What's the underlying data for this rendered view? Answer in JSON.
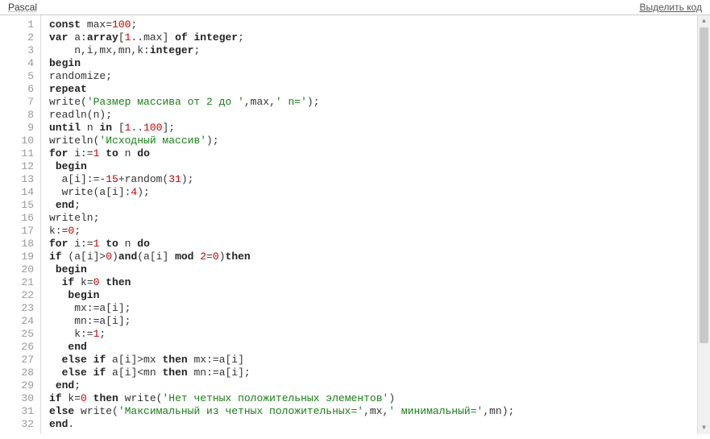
{
  "header": {
    "language": "Pascal",
    "select_code": "Выделить код"
  },
  "code": {
    "lines": [
      {
        "n": 1,
        "tokens": [
          [
            "kw",
            "const"
          ],
          [
            "",
            " max="
          ],
          [
            "num",
            "100"
          ],
          [
            "",
            ";"
          ]
        ]
      },
      {
        "n": 2,
        "tokens": [
          [
            "kw",
            "var"
          ],
          [
            "",
            " a:"
          ],
          [
            "kw",
            "array"
          ],
          [
            "",
            "["
          ],
          [
            "num",
            "1"
          ],
          [
            "",
            ".."
          ],
          [
            "",
            "max] "
          ],
          [
            "kw",
            "of"
          ],
          [
            "",
            " "
          ],
          [
            "kw",
            "integer"
          ],
          [
            "",
            ";"
          ]
        ]
      },
      {
        "n": 3,
        "tokens": [
          [
            "",
            "    n,i,mx,mn,k:"
          ],
          [
            "kw",
            "integer"
          ],
          [
            "",
            ";"
          ]
        ]
      },
      {
        "n": 4,
        "tokens": [
          [
            "kw",
            "begin"
          ]
        ]
      },
      {
        "n": 5,
        "tokens": [
          [
            "",
            "randomize;"
          ]
        ]
      },
      {
        "n": 6,
        "tokens": [
          [
            "kw",
            "repeat"
          ]
        ]
      },
      {
        "n": 7,
        "tokens": [
          [
            "",
            "write("
          ],
          [
            "str",
            "'Размер массива от 2 до '"
          ],
          [
            "",
            ",max,"
          ],
          [
            "str",
            "' n='"
          ],
          [
            "",
            ");"
          ]
        ]
      },
      {
        "n": 8,
        "tokens": [
          [
            "",
            "readln(n);"
          ]
        ]
      },
      {
        "n": 9,
        "tokens": [
          [
            "kw",
            "until"
          ],
          [
            "",
            " n "
          ],
          [
            "kw",
            "in"
          ],
          [
            "",
            " ["
          ],
          [
            "num",
            "1"
          ],
          [
            "",
            ".."
          ],
          [
            "num",
            "100"
          ],
          [
            "",
            "];"
          ]
        ]
      },
      {
        "n": 10,
        "tokens": [
          [
            "",
            "writeln("
          ],
          [
            "str",
            "'Исходный массив'"
          ],
          [
            "",
            ");"
          ]
        ]
      },
      {
        "n": 11,
        "tokens": [
          [
            "kw",
            "for"
          ],
          [
            "",
            " i:="
          ],
          [
            "num",
            "1"
          ],
          [
            "",
            " "
          ],
          [
            "kw",
            "to"
          ],
          [
            "",
            " n "
          ],
          [
            "kw",
            "do"
          ]
        ]
      },
      {
        "n": 12,
        "tokens": [
          [
            "",
            " "
          ],
          [
            "kw",
            "begin"
          ]
        ]
      },
      {
        "n": 13,
        "tokens": [
          [
            "",
            "  a[i]:=-"
          ],
          [
            "num",
            "15"
          ],
          [
            "",
            "+random("
          ],
          [
            "num",
            "31"
          ],
          [
            "",
            ");"
          ]
        ]
      },
      {
        "n": 14,
        "tokens": [
          [
            "",
            "  write(a[i]:"
          ],
          [
            "num",
            "4"
          ],
          [
            "",
            ");"
          ]
        ]
      },
      {
        "n": 15,
        "tokens": [
          [
            "",
            " "
          ],
          [
            "kw",
            "end"
          ],
          [
            "",
            ";"
          ]
        ]
      },
      {
        "n": 16,
        "tokens": [
          [
            "",
            "writeln;"
          ]
        ]
      },
      {
        "n": 17,
        "tokens": [
          [
            "",
            "k:="
          ],
          [
            "num",
            "0"
          ],
          [
            "",
            ";"
          ]
        ]
      },
      {
        "n": 18,
        "tokens": [
          [
            "kw",
            "for"
          ],
          [
            "",
            " i:="
          ],
          [
            "num",
            "1"
          ],
          [
            "",
            " "
          ],
          [
            "kw",
            "to"
          ],
          [
            "",
            " n "
          ],
          [
            "kw",
            "do"
          ]
        ]
      },
      {
        "n": 19,
        "tokens": [
          [
            "kw",
            "if"
          ],
          [
            "",
            " (a[i]>"
          ],
          [
            "num",
            "0"
          ],
          [
            "",
            ")"
          ],
          [
            "kw",
            "and"
          ],
          [
            "",
            "(a[i] "
          ],
          [
            "kw",
            "mod"
          ],
          [
            "",
            " "
          ],
          [
            "num",
            "2"
          ],
          [
            "",
            "="
          ],
          [
            "num",
            "0"
          ],
          [
            "",
            ")"
          ],
          [
            "kw",
            "then"
          ]
        ]
      },
      {
        "n": 20,
        "tokens": [
          [
            "",
            " "
          ],
          [
            "kw",
            "begin"
          ]
        ]
      },
      {
        "n": 21,
        "tokens": [
          [
            "",
            "  "
          ],
          [
            "kw",
            "if"
          ],
          [
            "",
            " k="
          ],
          [
            "num",
            "0"
          ],
          [
            "",
            " "
          ],
          [
            "kw",
            "then"
          ]
        ]
      },
      {
        "n": 22,
        "tokens": [
          [
            "",
            "   "
          ],
          [
            "kw",
            "begin"
          ]
        ]
      },
      {
        "n": 23,
        "tokens": [
          [
            "",
            "    mx:=a[i];"
          ]
        ]
      },
      {
        "n": 24,
        "tokens": [
          [
            "",
            "    mn:=a[i];"
          ]
        ]
      },
      {
        "n": 25,
        "tokens": [
          [
            "",
            "    k:="
          ],
          [
            "num",
            "1"
          ],
          [
            "",
            ";"
          ]
        ]
      },
      {
        "n": 26,
        "tokens": [
          [
            "",
            "   "
          ],
          [
            "kw",
            "end"
          ]
        ]
      },
      {
        "n": 27,
        "tokens": [
          [
            "",
            "  "
          ],
          [
            "kw",
            "else"
          ],
          [
            "",
            " "
          ],
          [
            "kw",
            "if"
          ],
          [
            "",
            " a[i]>mx "
          ],
          [
            "kw",
            "then"
          ],
          [
            "",
            " mx:=a[i]"
          ]
        ]
      },
      {
        "n": 28,
        "tokens": [
          [
            "",
            "  "
          ],
          [
            "kw",
            "else"
          ],
          [
            "",
            " "
          ],
          [
            "kw",
            "if"
          ],
          [
            "",
            " a[i]<mn "
          ],
          [
            "kw",
            "then"
          ],
          [
            "",
            " mn:=a[i];"
          ]
        ]
      },
      {
        "n": 29,
        "tokens": [
          [
            "",
            " "
          ],
          [
            "kw",
            "end"
          ],
          [
            "",
            ";"
          ]
        ]
      },
      {
        "n": 30,
        "tokens": [
          [
            "kw",
            "if"
          ],
          [
            "",
            " k="
          ],
          [
            "num",
            "0"
          ],
          [
            "",
            " "
          ],
          [
            "kw",
            "then"
          ],
          [
            "",
            " write("
          ],
          [
            "str",
            "'Нет четных положительных элементов'"
          ],
          [
            "",
            ")"
          ]
        ]
      },
      {
        "n": 31,
        "tokens": [
          [
            "kw",
            "else"
          ],
          [
            "",
            " write("
          ],
          [
            "str",
            "'Максимальный из четных положительных='"
          ],
          [
            "",
            ",mx,"
          ],
          [
            "str",
            "' минимальный='"
          ],
          [
            "",
            ",mn);"
          ]
        ]
      },
      {
        "n": 32,
        "tokens": [
          [
            "kw",
            "end"
          ],
          [
            "",
            "."
          ]
        ]
      }
    ]
  },
  "scrollbar": {
    "up": "▲",
    "down": "▼"
  }
}
